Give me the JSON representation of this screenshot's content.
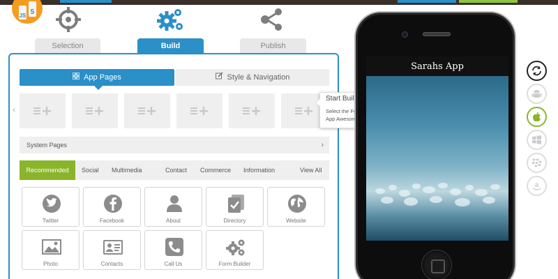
{
  "steps": [
    {
      "label": "Selection",
      "icon": "target-icon",
      "active": false
    },
    {
      "label": "Build",
      "icon": "gears-icon",
      "active": true
    },
    {
      "label": "Publish",
      "icon": "share-icon",
      "active": false
    }
  ],
  "html5_logo": {
    "left_badge": "JS",
    "right_badge": "5"
  },
  "build_panel": {
    "subtabs": {
      "app_pages": "App Pages",
      "style_navigation": "Style & Navigation"
    },
    "system_pages": "System Pages",
    "categories": [
      "Recommended",
      "Social",
      "Multimedia",
      "Contact",
      "Commerce",
      "Information"
    ],
    "view_all": "View All",
    "features": [
      {
        "label": "Twitter",
        "icon": "twitter-icon"
      },
      {
        "label": "Facebook",
        "icon": "facebook-icon"
      },
      {
        "label": "About",
        "icon": "person-icon"
      },
      {
        "label": "Directory",
        "icon": "directory-icon"
      },
      {
        "label": "Website",
        "icon": "globe-icon"
      },
      {
        "label": "Photo",
        "icon": "photo-icon"
      },
      {
        "label": "Contacts",
        "icon": "contact-card-icon"
      },
      {
        "label": "Call Us",
        "icon": "phone-icon"
      },
      {
        "label": "Form Builder",
        "icon": "gears-icon"
      }
    ]
  },
  "tooltip": {
    "title": "Start Building Your App!",
    "body": "Select the Features listed below and make the App Awesome!"
  },
  "phone": {
    "app_title": "Sarahs App"
  },
  "platforms": [
    "sync-icon",
    "android-icon",
    "apple-icon",
    "windows-icon",
    "blackberry-icon",
    "amazon-icon"
  ],
  "colors": {
    "accent_blue": "#2b8fc8",
    "accent_green": "#8ab52a",
    "step_gray": "#888888",
    "top_bar": "#3b2f2a"
  }
}
